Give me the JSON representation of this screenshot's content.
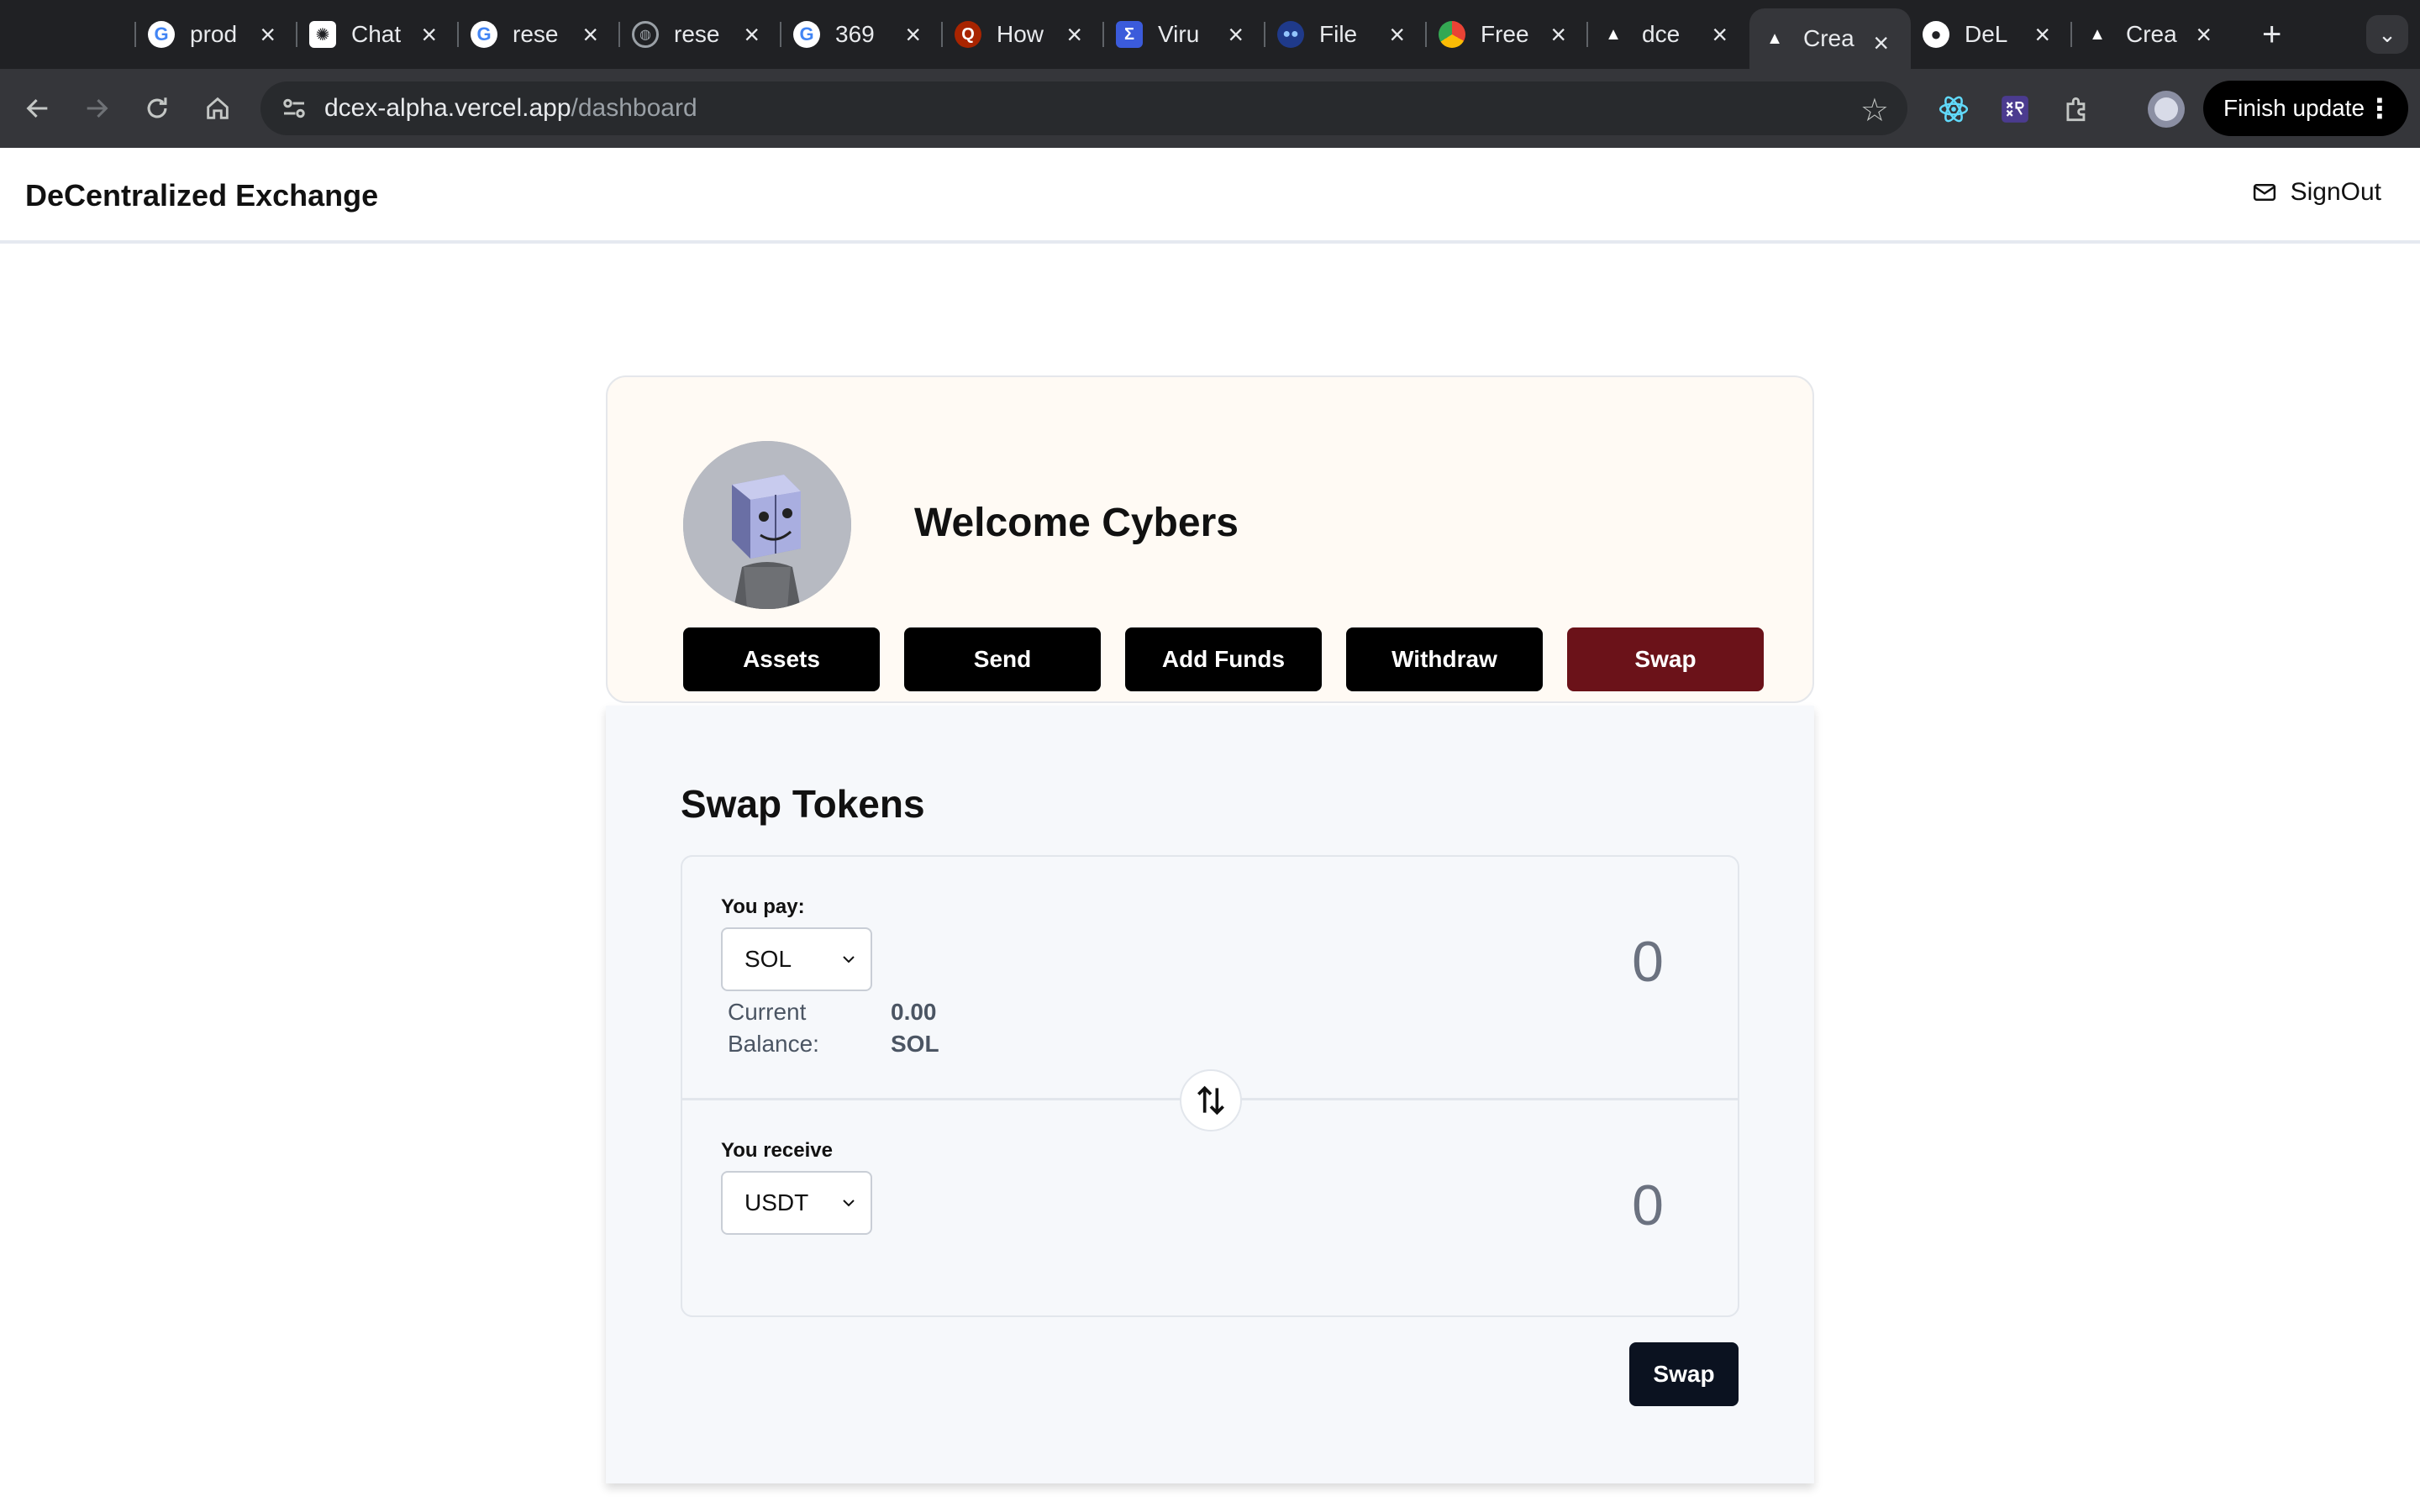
{
  "browser": {
    "tabs": [
      {
        "title": "prod",
        "favicon": "google-icon",
        "active": false
      },
      {
        "title": "Chat",
        "favicon": "openai-icon",
        "active": false
      },
      {
        "title": "rese",
        "favicon": "google-icon",
        "active": false
      },
      {
        "title": "rese",
        "favicon": "globe-icon",
        "active": false
      },
      {
        "title": "369",
        "favicon": "google-icon",
        "active": false
      },
      {
        "title": "How",
        "favicon": "quora-icon",
        "active": false
      },
      {
        "title": "Viru",
        "favicon": "virustotal-icon",
        "active": false
      },
      {
        "title": "File",
        "favicon": "file-icon",
        "active": false
      },
      {
        "title": "Free",
        "favicon": "chrome-icon",
        "active": false
      },
      {
        "title": "dce",
        "favicon": "vercel-icon",
        "active": false
      },
      {
        "title": "Crea",
        "favicon": "vercel-icon",
        "active": true
      },
      {
        "title": "DeL",
        "favicon": "github-icon",
        "active": false
      },
      {
        "title": "Crea",
        "favicon": "vercel-icon",
        "active": false
      }
    ],
    "new_tab": "+",
    "url_host": "dcex-alpha.vercel.app",
    "url_path": "/dashboard",
    "finish_update_label": "Finish update"
  },
  "header": {
    "brand": "DeCentralized Exchange",
    "signout_label": "SignOut"
  },
  "profile": {
    "welcome": "Welcome Cybers",
    "tabs": [
      {
        "label": "Assets",
        "active": false
      },
      {
        "label": "Send",
        "active": false
      },
      {
        "label": "Add Funds",
        "active": false
      },
      {
        "label": "Withdraw",
        "active": false
      },
      {
        "label": "Swap",
        "active": true
      }
    ]
  },
  "swap": {
    "title": "Swap Tokens",
    "pay": {
      "label": "You pay:",
      "token": "SOL",
      "amount": "0",
      "balance_label_line1": "Current",
      "balance_label_line2": "Balance:",
      "balance_value": "0.00",
      "balance_unit": "SOL"
    },
    "receive": {
      "label": "You receive",
      "token": "USDT",
      "amount": "0"
    },
    "swap_button": "Swap"
  },
  "colors": {
    "active_tab": "#6b1219",
    "card_bg": "#fffaf4",
    "swap_button": "#0b1220"
  }
}
